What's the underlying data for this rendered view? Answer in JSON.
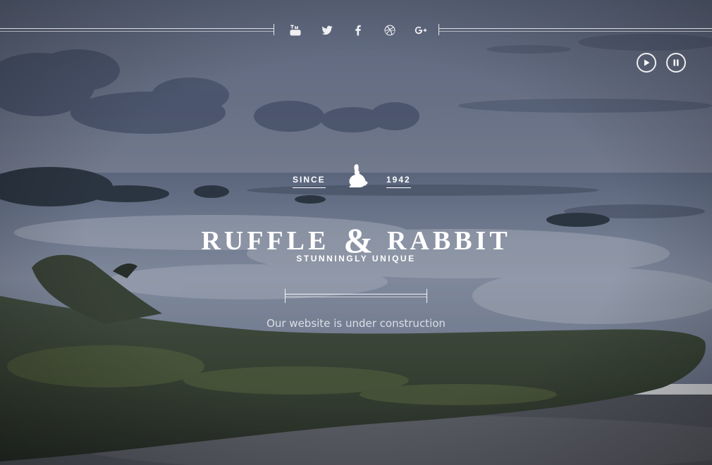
{
  "social": {
    "items": [
      {
        "name": "youtube-icon",
        "label": "You Tube"
      },
      {
        "name": "twitter-icon"
      },
      {
        "name": "facebook-icon"
      },
      {
        "name": "dribbble-icon"
      },
      {
        "name": "google-plus-icon"
      }
    ]
  },
  "media": {
    "play": "play-icon",
    "pause": "pause-icon"
  },
  "brand": {
    "since_label": "SINCE",
    "since_year": "1942",
    "name_left": "RUFFLE",
    "ampersand": "&",
    "name_right": "RABBIT",
    "tagline": "STUNNINGLY UNIQUE",
    "message": "Our website is under construction"
  },
  "colors": {
    "sky": "#6e7a92",
    "sea": "#8c97ab",
    "driftwood": "#3a4632",
    "sand": "#5a5c62"
  }
}
